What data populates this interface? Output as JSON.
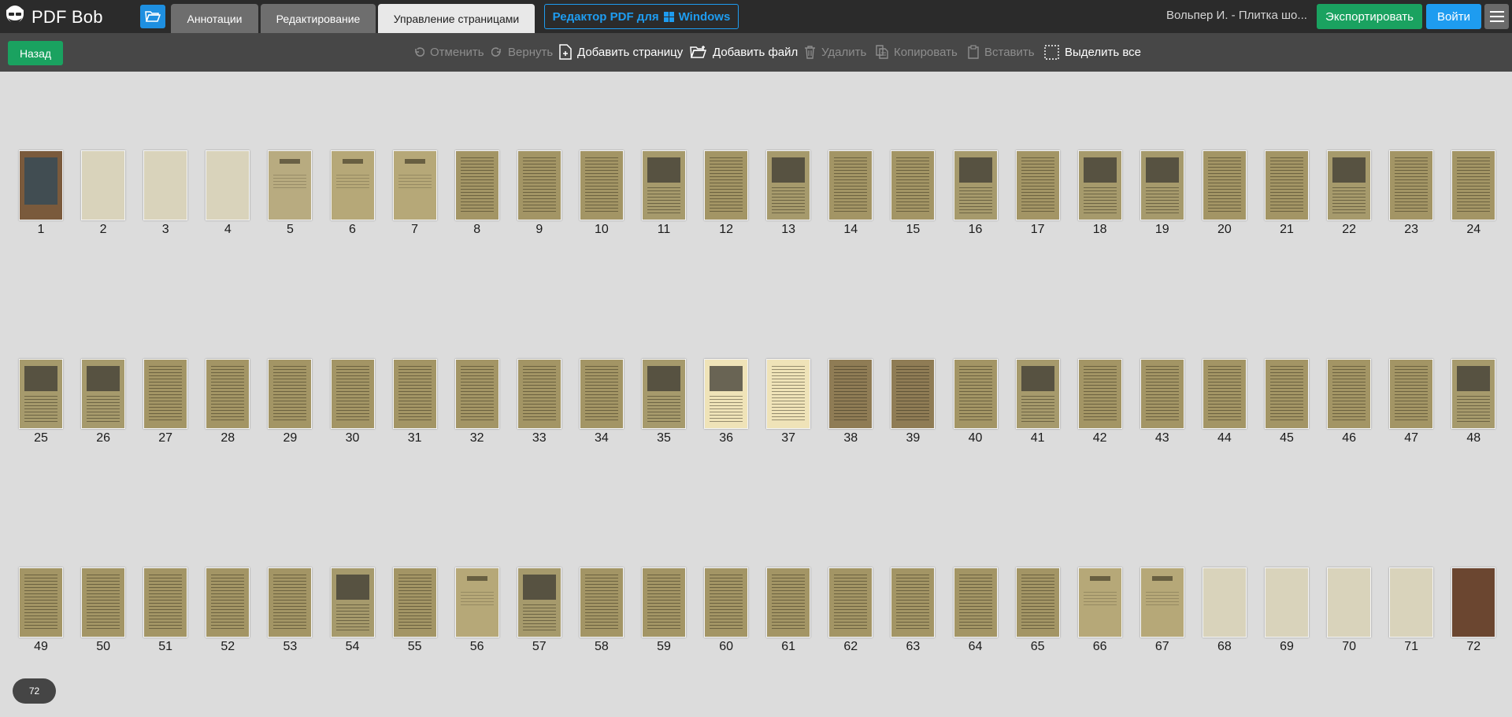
{
  "header": {
    "brand": "PDF Bob",
    "tabs": [
      {
        "label": "Аннотации",
        "active": false
      },
      {
        "label": "Редактирование",
        "active": false
      },
      {
        "label": "Управление страницами",
        "active": true
      }
    ],
    "promo_prefix": "Редактор PDF для",
    "promo_suffix": "Windows",
    "document_name": "Вольпер И. - Плитка шо...",
    "export_label": "Экспортировать",
    "login_label": "Войти"
  },
  "toolbar": {
    "back_label": "Назад",
    "undo_label": "Отменить",
    "redo_label": "Вернуть",
    "add_page_label": "Добавить страницу",
    "add_file_label": "Добавить файл",
    "delete_label": "Удалить",
    "copy_label": "Копировать",
    "paste_label": "Вставить",
    "select_all_label": "Выделить все"
  },
  "pages": [
    {
      "n": "1",
      "kind": "cover"
    },
    {
      "n": "2",
      "kind": "blank"
    },
    {
      "n": "3",
      "kind": "blank"
    },
    {
      "n": "4",
      "kind": "blank"
    },
    {
      "n": "5",
      "kind": "titlepage"
    },
    {
      "n": "6",
      "kind": "sparse"
    },
    {
      "n": "7",
      "kind": "sparse"
    },
    {
      "n": "8",
      "kind": "text"
    },
    {
      "n": "9",
      "kind": "text"
    },
    {
      "n": "10",
      "kind": "text"
    },
    {
      "n": "11",
      "kind": "illustration"
    },
    {
      "n": "12",
      "kind": "text"
    },
    {
      "n": "13",
      "kind": "illustration"
    },
    {
      "n": "14",
      "kind": "text"
    },
    {
      "n": "15",
      "kind": "text"
    },
    {
      "n": "16",
      "kind": "illustration"
    },
    {
      "n": "17",
      "kind": "text"
    },
    {
      "n": "18",
      "kind": "illustration"
    },
    {
      "n": "19",
      "kind": "illustration"
    },
    {
      "n": "20",
      "kind": "text"
    },
    {
      "n": "21",
      "kind": "text"
    },
    {
      "n": "22",
      "kind": "illustration"
    },
    {
      "n": "23",
      "kind": "text"
    },
    {
      "n": "24",
      "kind": "text"
    },
    {
      "n": "25",
      "kind": "illustration"
    },
    {
      "n": "26",
      "kind": "illustration"
    },
    {
      "n": "27",
      "kind": "text"
    },
    {
      "n": "28",
      "kind": "text"
    },
    {
      "n": "29",
      "kind": "text"
    },
    {
      "n": "30",
      "kind": "text"
    },
    {
      "n": "31",
      "kind": "text"
    },
    {
      "n": "32",
      "kind": "text"
    },
    {
      "n": "33",
      "kind": "text"
    },
    {
      "n": "34",
      "kind": "text"
    },
    {
      "n": "35",
      "kind": "illustration"
    },
    {
      "n": "36",
      "kind": "illustration"
    },
    {
      "n": "37",
      "kind": "text"
    },
    {
      "n": "38",
      "kind": "text"
    },
    {
      "n": "39",
      "kind": "text"
    },
    {
      "n": "40",
      "kind": "text"
    },
    {
      "n": "41",
      "kind": "illustration"
    },
    {
      "n": "42",
      "kind": "text"
    },
    {
      "n": "43",
      "kind": "text"
    },
    {
      "n": "44",
      "kind": "text"
    },
    {
      "n": "45",
      "kind": "text"
    },
    {
      "n": "46",
      "kind": "text"
    },
    {
      "n": "47",
      "kind": "text"
    },
    {
      "n": "48",
      "kind": "illustration"
    },
    {
      "n": "49",
      "kind": "text"
    },
    {
      "n": "50",
      "kind": "text"
    },
    {
      "n": "51",
      "kind": "text"
    },
    {
      "n": "52",
      "kind": "text"
    },
    {
      "n": "53",
      "kind": "text"
    },
    {
      "n": "54",
      "kind": "illustration"
    },
    {
      "n": "55",
      "kind": "text"
    },
    {
      "n": "56",
      "kind": "sparse"
    },
    {
      "n": "57",
      "kind": "illustration"
    },
    {
      "n": "58",
      "kind": "text"
    },
    {
      "n": "59",
      "kind": "text"
    },
    {
      "n": "60",
      "kind": "text"
    },
    {
      "n": "61",
      "kind": "text"
    },
    {
      "n": "62",
      "kind": "text"
    },
    {
      "n": "63",
      "kind": "text"
    },
    {
      "n": "64",
      "kind": "text"
    },
    {
      "n": "65",
      "kind": "text"
    },
    {
      "n": "66",
      "kind": "sparse"
    },
    {
      "n": "67",
      "kind": "sparse"
    },
    {
      "n": "68",
      "kind": "blank"
    },
    {
      "n": "69",
      "kind": "blank"
    },
    {
      "n": "70",
      "kind": "blank"
    },
    {
      "n": "71",
      "kind": "blank"
    },
    {
      "n": "72",
      "kind": "backcover"
    }
  ],
  "page_count": "72",
  "colors": {
    "accent_green": "#1aa260",
    "accent_blue": "#1e9cf0",
    "topbar": "#2b2b2b",
    "toolbar": "#474747",
    "canvas": "#dcdcdc"
  }
}
